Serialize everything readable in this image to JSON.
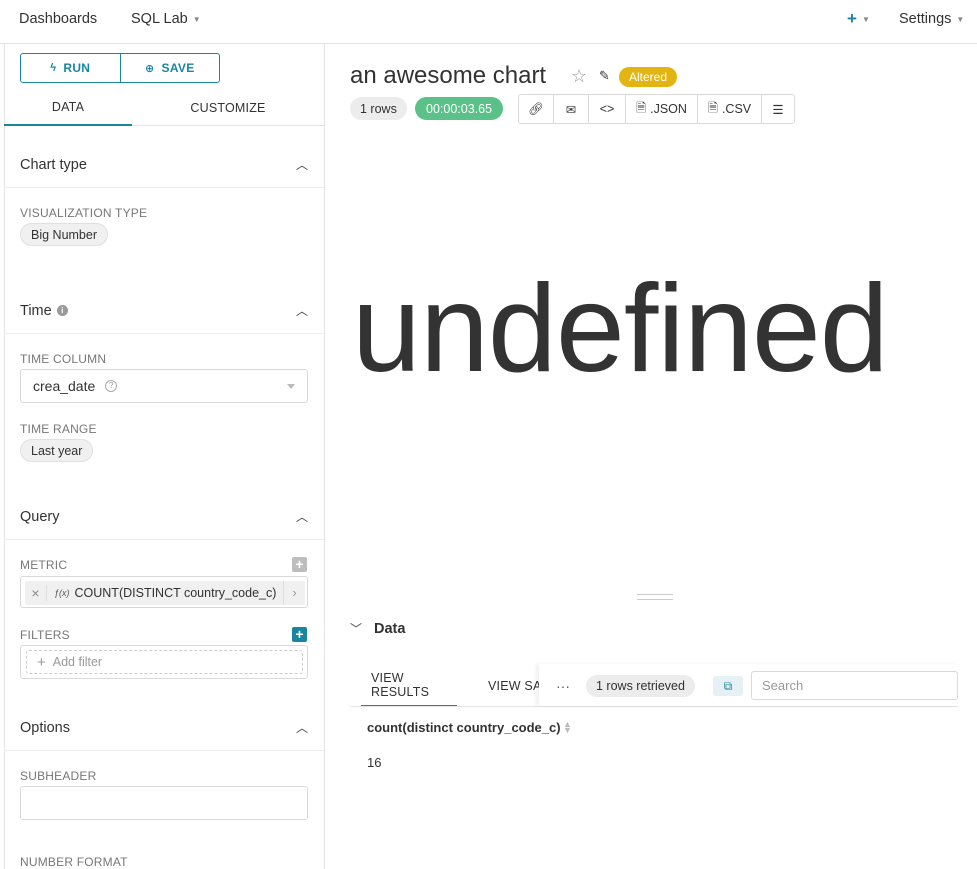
{
  "nav": {
    "dashboards": "Dashboards",
    "sql_lab": "SQL Lab",
    "settings": "Settings"
  },
  "left": {
    "run_label": "RUN",
    "save_label": "SAVE",
    "tabs": [
      "DATA",
      "CUSTOMIZE"
    ],
    "chart_type": {
      "title": "Chart type",
      "viz_label": "VISUALIZATION TYPE",
      "viz_value": "Big Number"
    },
    "time": {
      "title": "Time",
      "column_label": "TIME COLUMN",
      "column_value": "crea_date",
      "range_label": "TIME RANGE",
      "range_value": "Last year"
    },
    "query": {
      "title": "Query",
      "metric_label": "METRIC",
      "metric_value": "COUNT(DISTINCT country_code_c)",
      "filters_label": "FILTERS",
      "add_filter": "Add filter"
    },
    "options": {
      "title": "Options",
      "subheader_label": "SUBHEADER",
      "subheader_value": "",
      "number_format_label": "NUMBER FORMAT"
    }
  },
  "chart": {
    "title": "an awesome chart",
    "status_badge": "Altered",
    "rows_badge": "1 rows",
    "timer": "00:00:03.65",
    "toolbar": {
      "json": ".JSON",
      "csv": ".CSV"
    },
    "big_number": "undefined"
  },
  "data_pane": {
    "title": "Data",
    "tabs": [
      "VIEW RESULTS",
      "VIEW SAMPLES"
    ],
    "rows_retrieved": "1 rows retrieved",
    "search_placeholder": "Search",
    "columns": [
      "count(distinct country_code_c)"
    ],
    "rows": [
      [
        "16"
      ]
    ]
  },
  "colors": {
    "accent": "#1a85a0",
    "altered": "#e3b512",
    "timer": "#5ac189"
  }
}
